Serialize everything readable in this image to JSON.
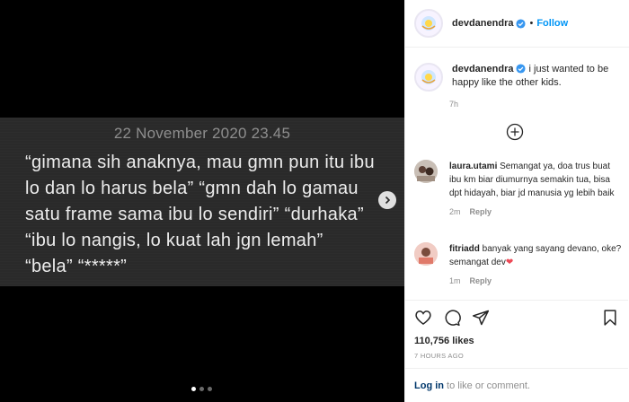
{
  "note": {
    "date": "22 November 2020 23.45",
    "text": "“gimana sih anaknya, mau gmn pun itu ibu lo dan lo harus bela” “gmn dah lo gamau satu frame sama ibu lo sendiri” “durhaka” “ibu lo nangis, lo kuat lah jgn lemah” “bela” “*****”"
  },
  "carousel": {
    "current": 1,
    "total": 3
  },
  "header": {
    "username": "devdanendra",
    "separator": "•",
    "follow_label": "Follow"
  },
  "caption": {
    "username": "devdanendra",
    "text": "i just wanted to be happy like the other kids.",
    "time": "7h"
  },
  "comments": [
    {
      "username": "laura.utami",
      "text": "Semangat ya, doa trus buat ibu km biar diumurnya semakin tua, bisa dpt hidayah, biar jd manusia yg lebih baik",
      "time": "2m",
      "reply_label": "Reply"
    },
    {
      "username": "fitriadd",
      "text": "banyak yang sayang devano, oke? semangat dev",
      "emoji": "❤",
      "time": "1m",
      "reply_label": "Reply"
    }
  ],
  "likes": "110,756 likes",
  "post_time": "7 HOURS AGO",
  "login": {
    "link_label": "Log in",
    "rest": " to like or comment."
  },
  "colors": {
    "accent": "#0095f6",
    "heart": "#ed4956"
  }
}
